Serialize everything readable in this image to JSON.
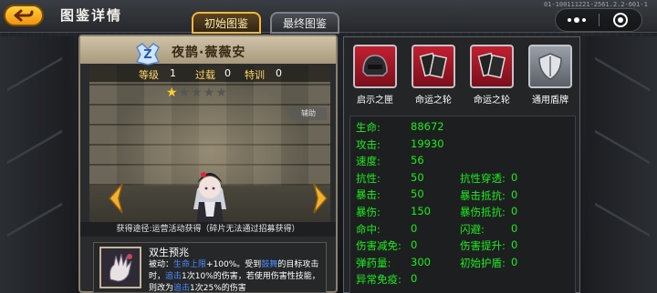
{
  "topbar": {
    "title": "图鉴详情",
    "build_id": "01-100111221-2561.2.2-601-1"
  },
  "tabs": [
    {
      "label": "初始图鉴",
      "active": true
    },
    {
      "label": "最终图鉴",
      "active": false
    }
  ],
  "character": {
    "rank": "Z",
    "name": "夜鹊·薇薇安",
    "stats_strip": {
      "level_label": "等级",
      "level": "1",
      "overload_label": "过载",
      "overload": "0",
      "training_label": "特训",
      "training": "0"
    },
    "stars": 1,
    "stars_max": 5,
    "assist_tag": "辅助",
    "source": "获得途径:运营活动获得（碎片无法通过招募获得）"
  },
  "skill": {
    "name": "双生预兆",
    "desc_parts": [
      "被动：",
      "生命上限",
      "+100%。受到",
      "鼓舞",
      "的目标攻击时，",
      "追击",
      "1次10%的伤害，若使用伤害性技能，则改为",
      "追击",
      "1次25%的伤害"
    ]
  },
  "equipment": [
    {
      "label": "启示之匣",
      "icon": "helmet-icon"
    },
    {
      "label": "命运之轮",
      "icon": "fate-card-icon"
    },
    {
      "label": "命运之轮",
      "icon": "fate-card-icon"
    },
    {
      "label": "通用盾牌",
      "icon": "shield-icon"
    }
  ],
  "stats_left": [
    {
      "k": "生命:",
      "v": "88672"
    },
    {
      "k": "攻击:",
      "v": "19930"
    },
    {
      "k": "速度:",
      "v": "56"
    },
    {
      "k": "抗性:",
      "v": "50"
    },
    {
      "k": "暴击:",
      "v": "50"
    },
    {
      "k": "暴伤:",
      "v": "150"
    },
    {
      "k": "命中:",
      "v": "0"
    },
    {
      "k": "伤害减免:",
      "v": "0"
    },
    {
      "k": "弹药量:",
      "v": "300"
    },
    {
      "k": "异常免疫:",
      "v": "0"
    }
  ],
  "stats_right": [
    {
      "k": "抗性穿透:",
      "v": "0"
    },
    {
      "k": "暴击抵抗:",
      "v": "0"
    },
    {
      "k": "暴伤抵抗:",
      "v": "0"
    },
    {
      "k": "闪避:",
      "v": "0"
    },
    {
      "k": "伤害提升:",
      "v": "0"
    },
    {
      "k": "初始护盾:",
      "v": "0"
    }
  ],
  "colors": {
    "accent": "#f1b737",
    "stat_text": "#19ee19",
    "highlight": "#4b8bff"
  }
}
